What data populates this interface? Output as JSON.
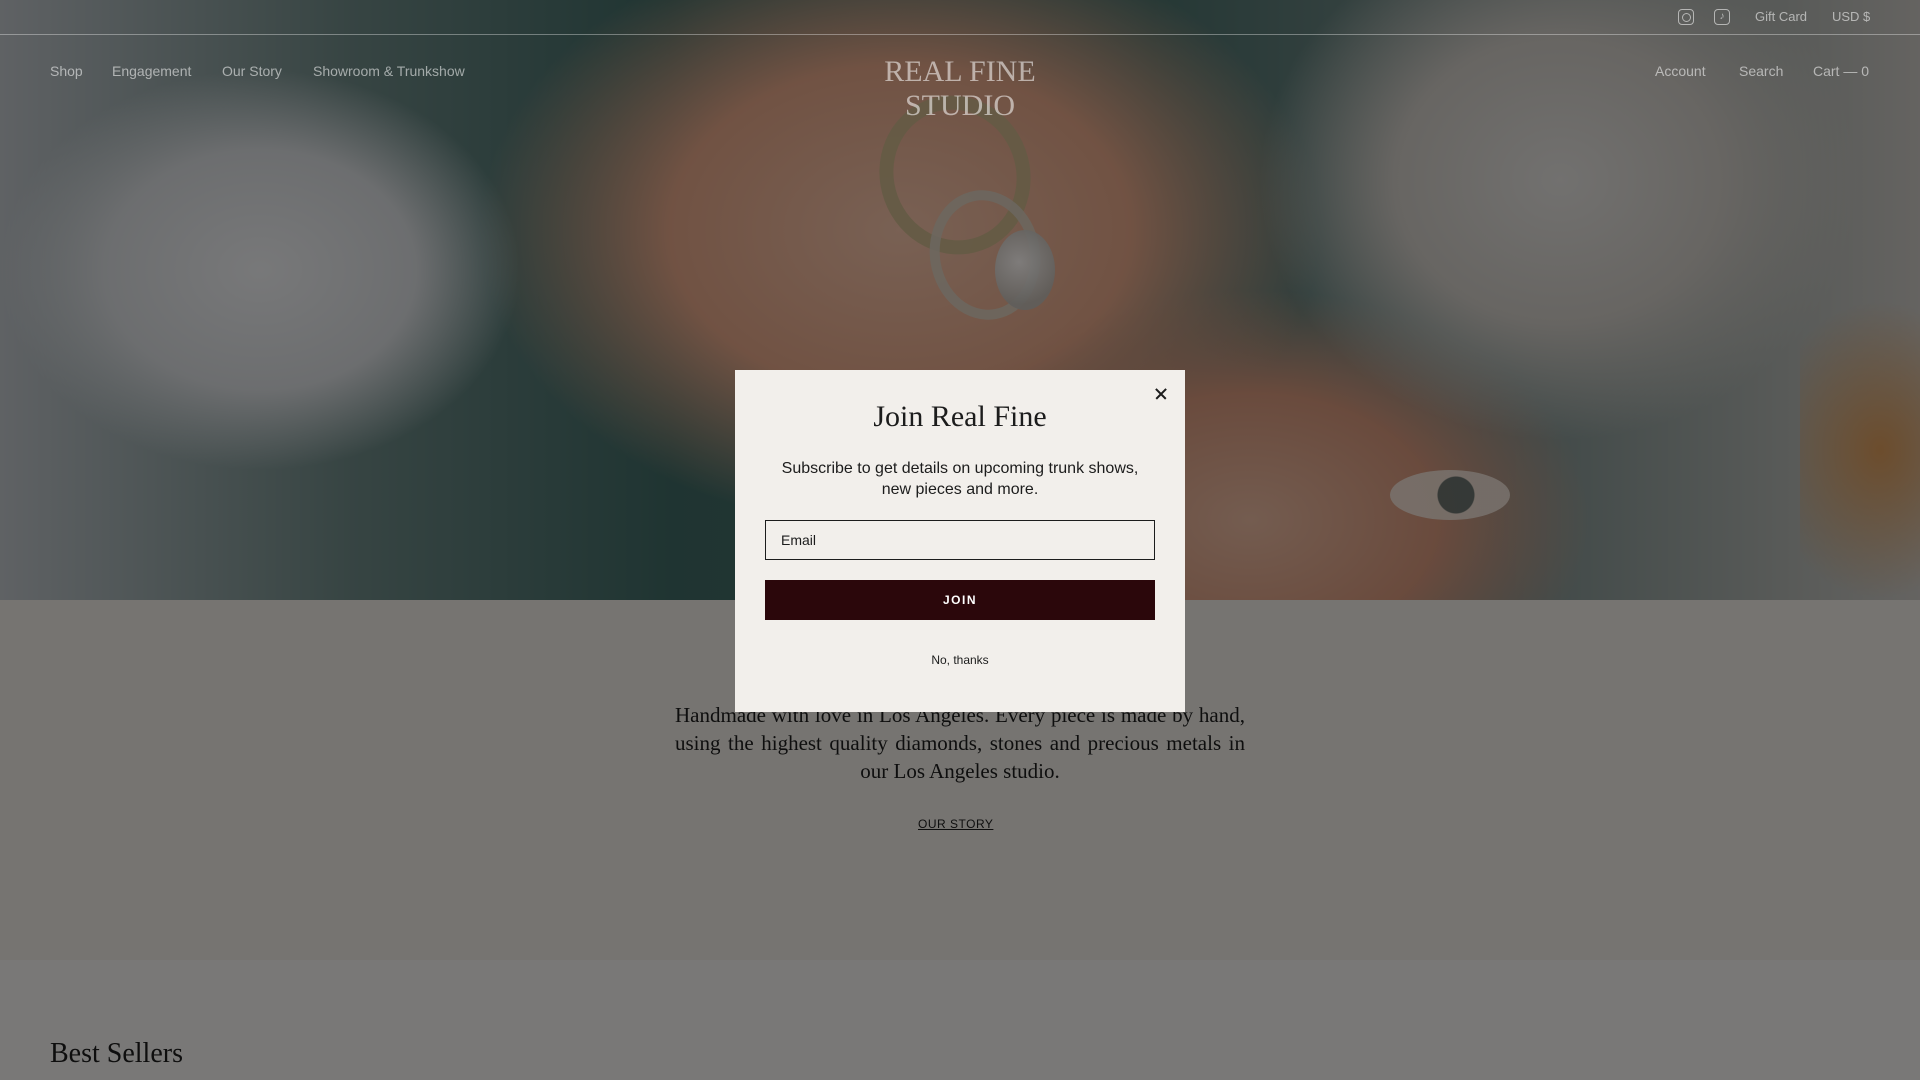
{
  "topbar": {
    "instagram_icon": "instagram-icon",
    "tiktok_icon": "tiktok-icon",
    "gift_card": "Gift Card",
    "currency": "USD $"
  },
  "nav": {
    "left": [
      "Shop",
      "Engagement",
      "Our Story",
      "Showroom & Trunkshow"
    ],
    "logo": "REAL FINE STUDIO",
    "account": "Account",
    "search": "Search",
    "cart": "Cart — 0"
  },
  "intro": {
    "text": "Handmade with love in Los Angeles. Every piece is made by hand, using the highest quality diamonds, stones and precious metals in our Los Angeles studio.",
    "link": "OUR STORY"
  },
  "bestsellers": {
    "title": "Best Sellers"
  },
  "modal": {
    "title": "Join Real Fine",
    "subtitle": "Subscribe to get details on upcoming trunk shows, new pieces and more.",
    "email_placeholder": "Email",
    "join_label": "JOIN",
    "decline_label": "No, thanks"
  },
  "colors": {
    "join_button": "#2b070b",
    "modal_bg": "#f2efeb"
  }
}
